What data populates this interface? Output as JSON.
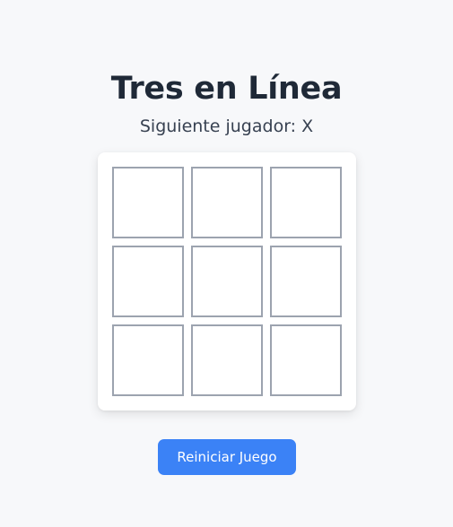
{
  "header": {
    "title": "Tres en Línea"
  },
  "status": {
    "text": "Siguiente jugador: X"
  },
  "board": {
    "cells": [
      "",
      "",
      "",
      "",
      "",
      "",
      "",
      "",
      ""
    ]
  },
  "controls": {
    "reset_label": "Reiniciar Juego"
  },
  "colors": {
    "background": "#f7f8fa",
    "accent": "#3b82f6",
    "cell_border": "#9ca3af",
    "title": "#1f2937"
  }
}
